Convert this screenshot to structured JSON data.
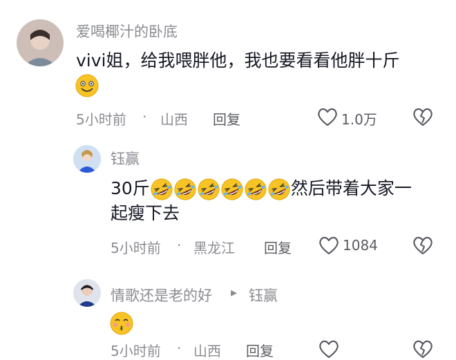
{
  "comments": [
    {
      "username": "爱喝椰汁的卧底",
      "text": "vivi姐，给我喂胖他，我也要看看他胖十斤",
      "emoji": "grinning-face",
      "time": "5小时前",
      "dot": "·",
      "location": "山西",
      "reply_label": "回复",
      "likes": "1.0万"
    },
    {
      "username": "钰赢",
      "text_prefix": "30斤",
      "emoji": "rolling-on-floor-laughing",
      "emoji_count": 6,
      "text_line1_suffix": "然后带着大家一",
      "text_line2": "起瘦下去",
      "time": "5小时前",
      "dot": "·",
      "location": "黑龙江",
      "reply_label": "回复",
      "likes": "1084"
    },
    {
      "username": "情歌还是老的好",
      "reply_arrow": "▸",
      "reply_to": "钰赢",
      "emoji": "kissing-closed-eyes",
      "time": "5小时前",
      "dot": "·",
      "location": "山西",
      "reply_label": "回复"
    }
  ]
}
